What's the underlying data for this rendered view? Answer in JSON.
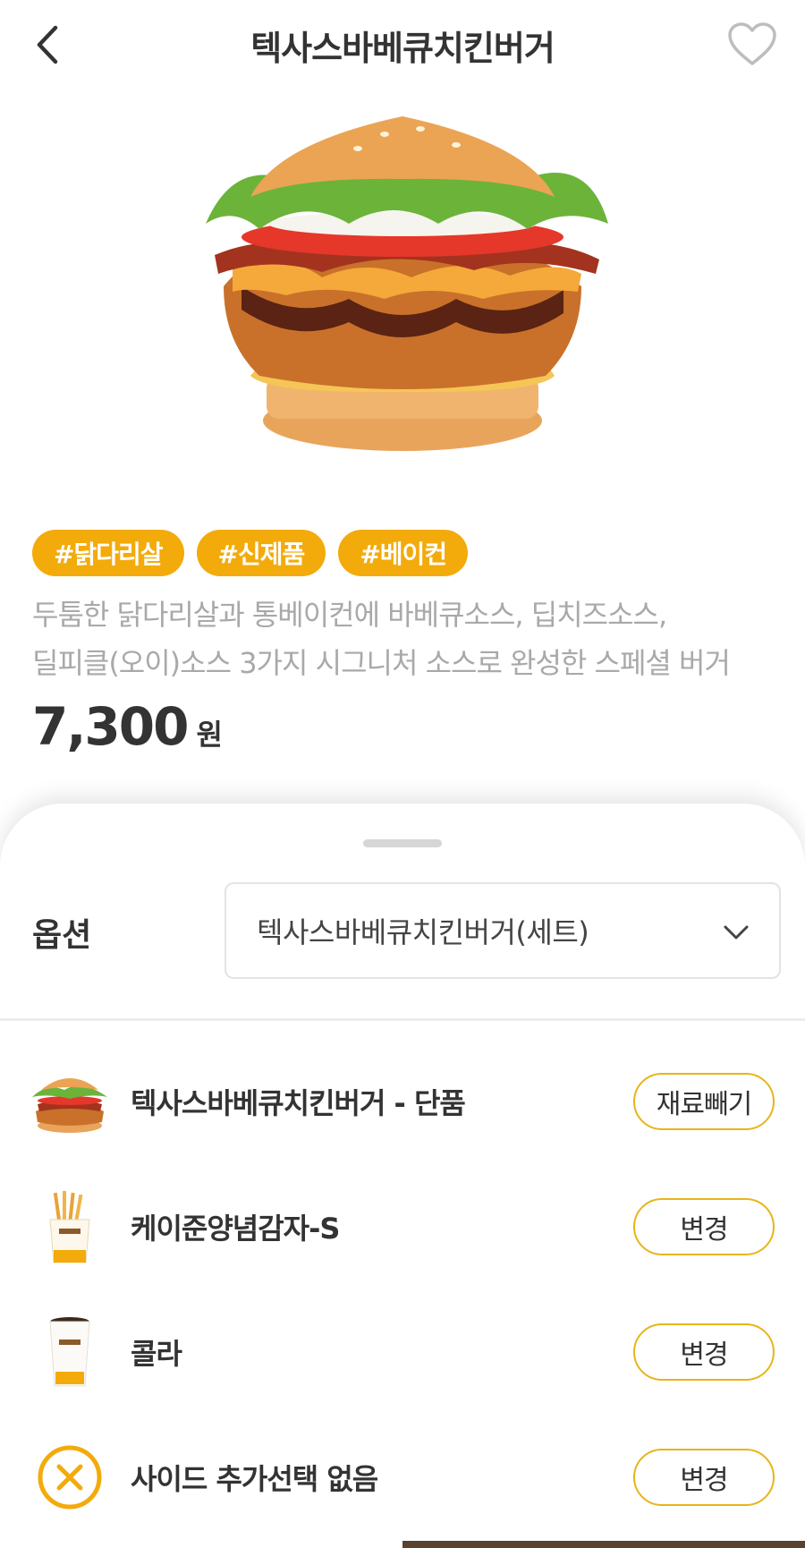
{
  "header": {
    "title": "텍사스바베큐치킨버거"
  },
  "product": {
    "tags": [
      "#닭다리살",
      "#신제품",
      "#베이컨"
    ],
    "description_line1": "두툼한 닭다리살과 통베이컨에 바베큐소스, 딥치즈소스,",
    "description_line2": "딜피클(오이)소스 3가지 시그니처 소스로 완성한 스페셜 버거",
    "price": "7,300",
    "price_unit": "원"
  },
  "options": {
    "label": "옵션",
    "selected": "텍사스바베큐치킨버거(세트)"
  },
  "set_items": [
    {
      "name": "텍사스바베큐치킨버거 - 단품",
      "button": "재료빼기",
      "icon": "burger-thumb"
    },
    {
      "name": "케이준양념감자-S",
      "button": "변경",
      "icon": "fries-thumb"
    },
    {
      "name": "콜라",
      "button": "변경",
      "icon": "cola-cup-thumb"
    },
    {
      "name": "사이드 추가선택 없음",
      "button": "변경",
      "icon": "close-circle-icon"
    }
  ],
  "colors": {
    "accent": "#f3ab0b",
    "pill_border": "#e8b419",
    "text": "#333333",
    "muted": "#a9a9a9"
  }
}
